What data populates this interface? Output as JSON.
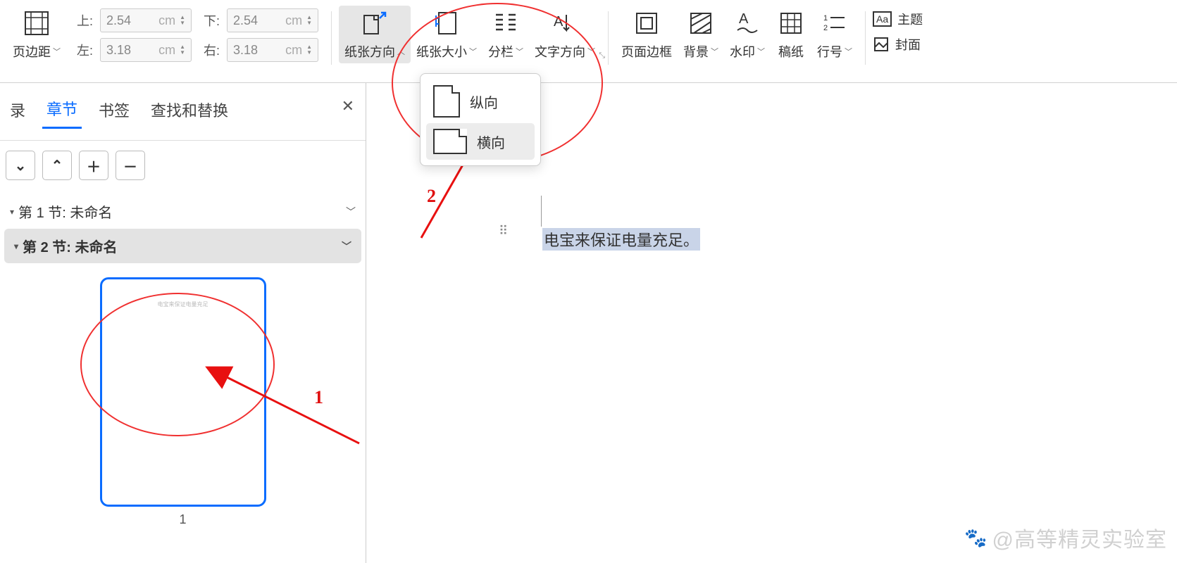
{
  "ribbon": {
    "margins_btn": "页边距",
    "top": {
      "label": "上:",
      "value": "2.54",
      "unit": "cm"
    },
    "bottom": {
      "label": "下:",
      "value": "2.54",
      "unit": "cm"
    },
    "left": {
      "label": "左:",
      "value": "3.18",
      "unit": "cm"
    },
    "right": {
      "label": "右:",
      "value": "3.18",
      "unit": "cm"
    },
    "orientation": "纸张方向",
    "size": "纸张大小",
    "columns": "分栏",
    "text_dir": "文字方向",
    "border": "页面边框",
    "background": "背景",
    "watermark": "水印",
    "genko": "稿纸",
    "line_num": "行号",
    "theme": "主题",
    "cover": "封面"
  },
  "popup": {
    "portrait": "纵向",
    "landscape": "横向"
  },
  "panel": {
    "tabs": {
      "toc": "录",
      "chapter": "章节",
      "bookmark": "书签",
      "find": "查找和替换"
    },
    "sections": [
      {
        "label": "第 1 节: 未命名"
      },
      {
        "label": "第 2 节: 未命名"
      }
    ],
    "thumb_num": "1"
  },
  "doc": {
    "text": "电宝来保证电量充足。"
  },
  "annotations": {
    "n1": "1",
    "n2": "2"
  },
  "watermark": "@高等精灵实验室"
}
